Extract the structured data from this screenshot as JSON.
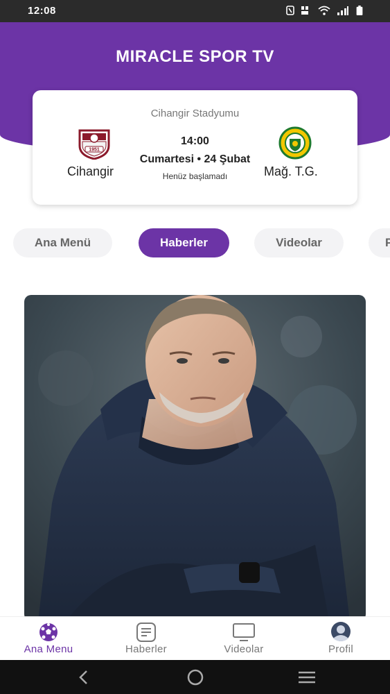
{
  "status_bar": {
    "time": "12:08",
    "icons": [
      "nfc-icon",
      "volte-icon",
      "wifi-icon",
      "signal-icon",
      "battery-icon"
    ]
  },
  "app": {
    "title": "MIRACLE SPOR TV",
    "accent_color": "#6c34a6"
  },
  "match": {
    "venue": "Cihangir Stadyumu",
    "home_team": "Cihangir",
    "away_team": "Mağ. T.G.",
    "time": "14:00",
    "date": "Cumartesi • 24 Şubat",
    "status": "Henüz başlamadı",
    "home_crest_year": "1951"
  },
  "tabs": [
    {
      "label": "Ana Menü",
      "active": false
    },
    {
      "label": "Haberler",
      "active": true
    },
    {
      "label": "Videolar",
      "active": false
    },
    {
      "label": "P",
      "active": false
    }
  ],
  "bottom_nav": [
    {
      "label": "Ana Menu",
      "icon": "soccer-ball-icon",
      "active": true
    },
    {
      "label": "Haberler",
      "icon": "news-icon",
      "active": false
    },
    {
      "label": "Videolar",
      "icon": "monitor-icon",
      "active": false
    },
    {
      "label": "Profil",
      "icon": "user-avatar-icon",
      "active": false
    }
  ],
  "system_nav": [
    "back-icon",
    "home-icon",
    "recents-icon"
  ]
}
